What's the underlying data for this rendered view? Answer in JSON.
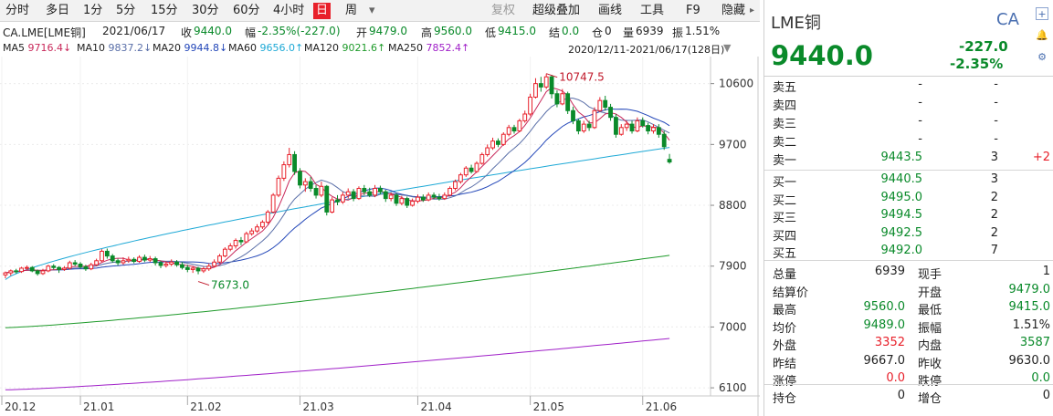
{
  "toolbar": {
    "items": [
      "分时",
      "多日",
      "1分",
      "5分",
      "15分",
      "30分",
      "60分",
      "4小时",
      "日",
      "周"
    ],
    "active": "日",
    "dropdown": "▾",
    "right_items": [
      "复权",
      "超级叠加",
      "画线",
      "工具",
      "F9",
      "隐藏"
    ]
  },
  "info": {
    "symbol": "CA.LME[LME铜]",
    "date": "2021/06/17",
    "close_label": "收",
    "close": "9440.0",
    "amp_label": "幅",
    "amp": "-2.35%(-227.0)",
    "open_label": "开",
    "open": "9479.0",
    "high_label": "高",
    "high": "9560.0",
    "low_label": "低",
    "low": "9415.0",
    "settle_label": "结",
    "settle": "0.0",
    "oi_label": "仓",
    "oi": "0",
    "vol_label": "量",
    "vol": "6939",
    "range_label": "振",
    "range": "1.51%",
    "period": "2020/12/11-2021/06/17(128日)"
  },
  "ma": [
    {
      "label": "MA5",
      "value": "9716.4↓",
      "color": "#c8285a"
    },
    {
      "label": "MA10",
      "value": "9837.2↓",
      "color": "#5a6fa8"
    },
    {
      "label": "MA20",
      "value": "9944.8↓",
      "color": "#2246b8"
    },
    {
      "label": "MA60",
      "value": "9656.0↑",
      "color": "#1ea9d6"
    },
    {
      "label": "MA120",
      "value": "9021.6↑",
      "color": "#1e9a2a"
    },
    {
      "label": "MA250",
      "value": "7852.4↑",
      "color": "#a020c8"
    }
  ],
  "chart_data": {
    "type": "candlestick",
    "title": "",
    "x_ticks": [
      "20.12",
      "21.01",
      "21.02",
      "21.03",
      "21.04",
      "21.05",
      "21.06"
    ],
    "y_ticks": [
      6100,
      7000,
      7900,
      8800,
      9700,
      10600
    ],
    "ylim": [
      5980,
      11000
    ],
    "n_days": 128,
    "annotations": [
      {
        "text": "10747.5",
        "value": 10747.5,
        "kind": "high"
      },
      {
        "text": "7673.0",
        "value": 7673.0,
        "kind": "low"
      }
    ],
    "candles": [
      [
        7770,
        7800,
        7720,
        7820
      ],
      [
        7800,
        7830,
        7760,
        7850
      ],
      [
        7830,
        7820,
        7790,
        7860
      ],
      [
        7820,
        7870,
        7800,
        7890
      ],
      [
        7870,
        7880,
        7840,
        7910
      ],
      [
        7880,
        7830,
        7810,
        7900
      ],
      [
        7830,
        7790,
        7760,
        7850
      ],
      [
        7790,
        7830,
        7770,
        7860
      ],
      [
        7830,
        7900,
        7810,
        7920
      ],
      [
        7900,
        7880,
        7850,
        7930
      ],
      [
        7880,
        7850,
        7800,
        7900
      ],
      [
        7850,
        7870,
        7830,
        7900
      ],
      [
        7870,
        7950,
        7850,
        7980
      ],
      [
        7950,
        7930,
        7900,
        7990
      ],
      [
        7930,
        7890,
        7860,
        7960
      ],
      [
        7890,
        7860,
        7830,
        7920
      ],
      [
        7860,
        7920,
        7840,
        7950
      ],
      [
        7920,
        7980,
        7900,
        8010
      ],
      [
        7980,
        8120,
        7960,
        8150
      ],
      [
        8120,
        8050,
        8010,
        8160
      ],
      [
        8050,
        7980,
        7950,
        8080
      ],
      [
        7980,
        7950,
        7910,
        8010
      ],
      [
        7950,
        7980,
        7920,
        8030
      ],
      [
        7980,
        8000,
        7950,
        8040
      ],
      [
        8000,
        7970,
        7940,
        8030
      ],
      [
        7970,
        8030,
        7950,
        8060
      ],
      [
        8030,
        7990,
        7960,
        8070
      ],
      [
        7990,
        8010,
        7960,
        8050
      ],
      [
        8010,
        7950,
        7910,
        8040
      ],
      [
        7950,
        7910,
        7870,
        7980
      ],
      [
        7910,
        7930,
        7880,
        7970
      ],
      [
        7930,
        7960,
        7900,
        8000
      ],
      [
        7960,
        7920,
        7890,
        7990
      ],
      [
        7920,
        7880,
        7850,
        7960
      ],
      [
        7880,
        7850,
        7810,
        7920
      ],
      [
        7850,
        7870,
        7800,
        7900
      ],
      [
        7870,
        7830,
        7780,
        7890
      ],
      [
        7830,
        7860,
        7800,
        7890
      ],
      [
        7860,
        7900,
        7830,
        7940
      ],
      [
        7900,
        7960,
        7880,
        8000
      ],
      [
        7960,
        8050,
        7940,
        8080
      ],
      [
        8050,
        8150,
        8030,
        8180
      ],
      [
        8150,
        8200,
        8120,
        8240
      ],
      [
        8200,
        8280,
        8160,
        8310
      ],
      [
        8280,
        8260,
        8210,
        8330
      ],
      [
        8260,
        8380,
        8240,
        8410
      ],
      [
        8380,
        8420,
        8350,
        8460
      ],
      [
        8420,
        8480,
        8390,
        8520
      ],
      [
        8480,
        8550,
        8450,
        8580
      ],
      [
        8550,
        8700,
        8520,
        8730
      ],
      [
        8700,
        8950,
        8680,
        8980
      ],
      [
        8950,
        9200,
        8920,
        9240
      ],
      [
        9200,
        9400,
        9160,
        9450
      ],
      [
        9400,
        9550,
        9360,
        9650
      ],
      [
        9550,
        9300,
        9250,
        9600
      ],
      [
        9300,
        9100,
        9050,
        9350
      ],
      [
        9100,
        9150,
        9000,
        9200
      ],
      [
        9150,
        9050,
        9000,
        9220
      ],
      [
        9050,
        8950,
        8900,
        9100
      ],
      [
        8950,
        9080,
        8920,
        9150
      ],
      [
        9080,
        8700,
        8650,
        9100
      ],
      [
        8700,
        8880,
        8680,
        8920
      ],
      [
        8880,
        8850,
        8800,
        8950
      ],
      [
        8850,
        8950,
        8820,
        9000
      ],
      [
        8950,
        9000,
        8900,
        9050
      ],
      [
        9000,
        8900,
        8860,
        9040
      ],
      [
        8900,
        9050,
        8880,
        9080
      ],
      [
        9050,
        9000,
        8950,
        9100
      ],
      [
        9000,
        8950,
        8920,
        9060
      ],
      [
        8950,
        9050,
        8920,
        9100
      ],
      [
        9050,
        9000,
        8960,
        9090
      ],
      [
        9000,
        8900,
        8850,
        9030
      ],
      [
        8900,
        8950,
        8860,
        8990
      ],
      [
        8950,
        8830,
        8790,
        8980
      ],
      [
        8830,
        8900,
        8800,
        8940
      ],
      [
        8900,
        8800,
        8760,
        8930
      ],
      [
        8800,
        8860,
        8780,
        8900
      ],
      [
        8860,
        8920,
        8830,
        8960
      ],
      [
        8920,
        8880,
        8850,
        8960
      ],
      [
        8880,
        8950,
        8860,
        8990
      ],
      [
        8950,
        8920,
        8890,
        8990
      ],
      [
        8920,
        8900,
        8870,
        8970
      ],
      [
        8900,
        8950,
        8880,
        8990
      ],
      [
        8950,
        9050,
        8930,
        9080
      ],
      [
        9050,
        9150,
        9020,
        9180
      ],
      [
        9150,
        9250,
        9120,
        9280
      ],
      [
        9250,
        9350,
        9220,
        9380
      ],
      [
        9350,
        9300,
        9270,
        9400
      ],
      [
        9300,
        9420,
        9280,
        9450
      ],
      [
        9420,
        9550,
        9400,
        9580
      ],
      [
        9550,
        9650,
        9520,
        9700
      ],
      [
        9650,
        9750,
        9620,
        9800
      ],
      [
        9750,
        9700,
        9660,
        9790
      ],
      [
        9700,
        9850,
        9680,
        9880
      ],
      [
        9850,
        9950,
        9820,
        9990
      ],
      [
        9950,
        9900,
        9860,
        9990
      ],
      [
        9900,
        10050,
        9880,
        10080
      ],
      [
        10050,
        10150,
        10020,
        10200
      ],
      [
        10150,
        10400,
        10120,
        10450
      ],
      [
        10400,
        10600,
        10380,
        10680
      ],
      [
        10600,
        10550,
        10480,
        10700
      ],
      [
        10550,
        10700,
        10520,
        10747.5
      ],
      [
        10700,
        10450,
        10380,
        10730
      ],
      [
        10450,
        10300,
        10250,
        10500
      ],
      [
        10300,
        10450,
        10280,
        10520
      ],
      [
        10450,
        10200,
        10150,
        10480
      ],
      [
        10200,
        10050,
        10000,
        10260
      ],
      [
        10050,
        9900,
        9850,
        10080
      ],
      [
        9900,
        10000,
        9870,
        10050
      ],
      [
        10000,
        9950,
        9900,
        10050
      ],
      [
        9950,
        10200,
        9930,
        10250
      ],
      [
        10200,
        10350,
        10180,
        10400
      ],
      [
        10350,
        10250,
        10200,
        10420
      ],
      [
        10250,
        10100,
        10050,
        10300
      ],
      [
        10100,
        9850,
        9800,
        10150
      ],
      [
        9850,
        9950,
        9830,
        10000
      ],
      [
        9950,
        10000,
        9900,
        10050
      ],
      [
        10000,
        9900,
        9860,
        10050
      ],
      [
        9900,
        10050,
        9880,
        10100
      ],
      [
        10050,
        9980,
        9950,
        10100
      ],
      [
        9980,
        9900,
        9850,
        10020
      ],
      [
        9900,
        9950,
        9860,
        10000
      ],
      [
        9950,
        9850,
        9800,
        10000
      ],
      [
        9850,
        9667,
        9620,
        9900
      ],
      [
        9479,
        9440,
        9415,
        9560
      ]
    ],
    "series": [
      {
        "name": "MA250",
        "color": "#a020c8",
        "start": 6070,
        "end": 6830
      },
      {
        "name": "MA120",
        "color": "#1e9a2a",
        "start": 6990,
        "end": 8060
      },
      {
        "name": "MA60",
        "color": "#1ea9d6",
        "start": 7700,
        "end": 9656
      }
    ]
  },
  "panel": {
    "title": "LME铜",
    "code": "CA",
    "price": "9440.0",
    "change": "-227.0",
    "change_pct": "-2.35%",
    "sells": [
      {
        "label": "卖五",
        "price": "-",
        "vol": "-",
        "chg": ""
      },
      {
        "label": "卖四",
        "price": "-",
        "vol": "-",
        "chg": ""
      },
      {
        "label": "卖三",
        "price": "-",
        "vol": "-",
        "chg": ""
      },
      {
        "label": "卖二",
        "price": "-",
        "vol": "-",
        "chg": ""
      },
      {
        "label": "卖一",
        "price": "9443.5",
        "vol": "3",
        "chg": "+2"
      }
    ],
    "buys": [
      {
        "label": "买一",
        "price": "9440.5",
        "vol": "3"
      },
      {
        "label": "买二",
        "price": "9495.0",
        "vol": "2"
      },
      {
        "label": "买三",
        "price": "9494.5",
        "vol": "2"
      },
      {
        "label": "买四",
        "price": "9492.5",
        "vol": "2"
      },
      {
        "label": "买五",
        "price": "9492.0",
        "vol": "7"
      }
    ],
    "stats": [
      {
        "l1": "总量",
        "v1": "6939",
        "c1": "",
        "l2": "现手",
        "v2": "1",
        "c2": ""
      },
      {
        "l1": "结算价",
        "v1": "",
        "c1": "",
        "l2": "开盘",
        "v2": "9479.0",
        "c2": "green"
      },
      {
        "l1": "最高",
        "v1": "9560.0",
        "c1": "green",
        "l2": "最低",
        "v2": "9415.0",
        "c2": "green"
      },
      {
        "l1": "均价",
        "v1": "9489.0",
        "c1": "green",
        "l2": "振幅",
        "v2": "1.51%",
        "c2": ""
      },
      {
        "l1": "外盘",
        "v1": "3352",
        "c1": "red",
        "l2": "内盘",
        "v2": "3587",
        "c2": "green"
      },
      {
        "l1": "昨结",
        "v1": "9667.0",
        "c1": "",
        "l2": "昨收",
        "v2": "9630.0",
        "c2": ""
      },
      {
        "l1": "涨停",
        "v1": "0.0",
        "c1": "red",
        "l2": "跌停",
        "v2": "0.0",
        "c2": "green"
      },
      {
        "l1": "持仓",
        "v1": "0",
        "c1": "",
        "l2": "增仓",
        "v2": "0",
        "c2": ""
      }
    ]
  }
}
